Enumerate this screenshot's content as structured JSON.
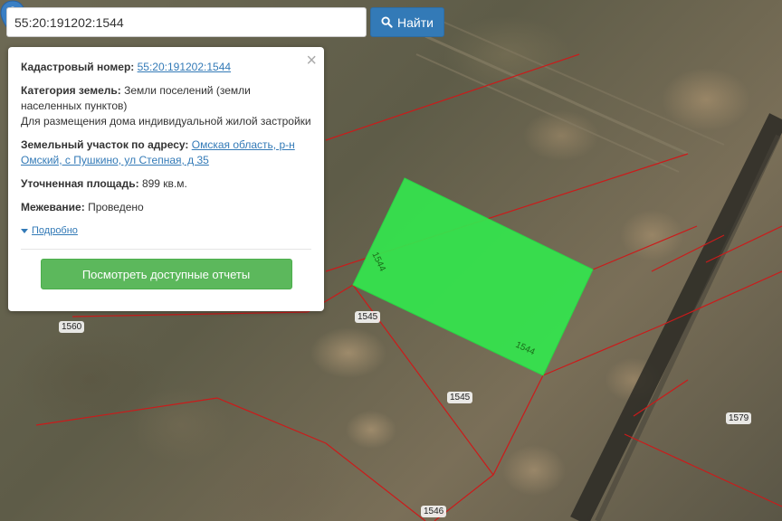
{
  "search": {
    "value": "55:20:191202:1544",
    "button_label": "Найти"
  },
  "popup": {
    "cadastral_label": "Кадастровый номер:",
    "cadastral_value": "55:20:191202:1544",
    "category_label": "Категория земель:",
    "category_value": "Земли поселений (земли населенных пунктов)",
    "purpose": "Для размещения дома индивидуальной жилой застройки",
    "address_label": "Земельный участок по адресу:",
    "address_value": "Омская область, р-н Омский, с Пушкино, ул Степная, д 35",
    "area_label": "Уточненная площадь:",
    "area_value": "899 кв.м.",
    "survey_label": "Межевание:",
    "survey_value": "Проведено",
    "details_link": "Подробно",
    "reports_button": "Посмотреть доступные отчеты",
    "close_symbol": "×"
  },
  "map": {
    "parcel_color": "#33e64d",
    "boundary_color": "#cc1a1a",
    "labels": {
      "p1544_top": "1544",
      "p1544_bottom": "1544",
      "p1545_a": "1545",
      "p1545_b": "1545",
      "p1560": "1560",
      "p1579": "1579",
      "p1546": "1546"
    }
  },
  "icons": {
    "search": "search-icon",
    "close": "close-icon",
    "marker": "map-marker-icon",
    "caret": "caret-down-icon"
  }
}
